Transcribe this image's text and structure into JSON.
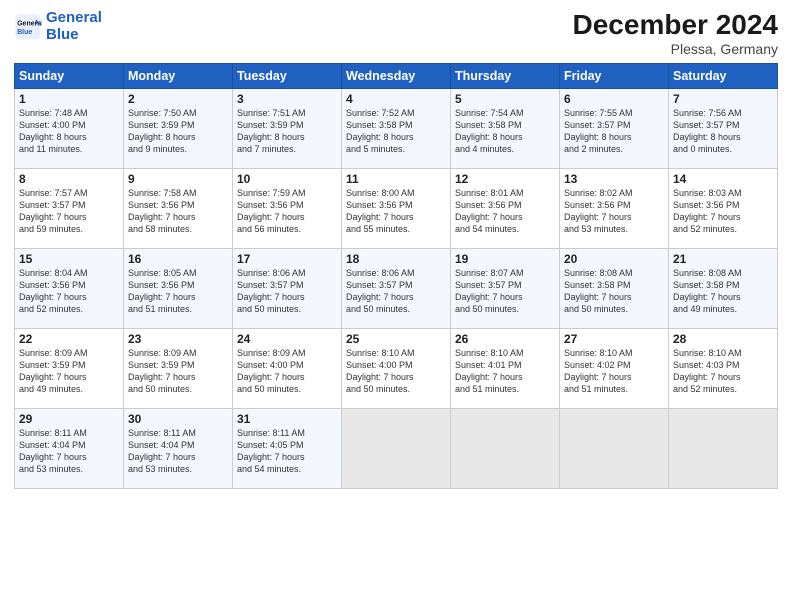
{
  "logo": {
    "line1": "General",
    "line2": "Blue"
  },
  "title": "December 2024",
  "subtitle": "Plessa, Germany",
  "days_of_week": [
    "Sunday",
    "Monday",
    "Tuesday",
    "Wednesday",
    "Thursday",
    "Friday",
    "Saturday"
  ],
  "weeks": [
    [
      {
        "day": "1",
        "info": "Sunrise: 7:48 AM\nSunset: 4:00 PM\nDaylight: 8 hours\nand 11 minutes."
      },
      {
        "day": "2",
        "info": "Sunrise: 7:50 AM\nSunset: 3:59 PM\nDaylight: 8 hours\nand 9 minutes."
      },
      {
        "day": "3",
        "info": "Sunrise: 7:51 AM\nSunset: 3:59 PM\nDaylight: 8 hours\nand 7 minutes."
      },
      {
        "day": "4",
        "info": "Sunrise: 7:52 AM\nSunset: 3:58 PM\nDaylight: 8 hours\nand 5 minutes."
      },
      {
        "day": "5",
        "info": "Sunrise: 7:54 AM\nSunset: 3:58 PM\nDaylight: 8 hours\nand 4 minutes."
      },
      {
        "day": "6",
        "info": "Sunrise: 7:55 AM\nSunset: 3:57 PM\nDaylight: 8 hours\nand 2 minutes."
      },
      {
        "day": "7",
        "info": "Sunrise: 7:56 AM\nSunset: 3:57 PM\nDaylight: 8 hours\nand 0 minutes."
      }
    ],
    [
      {
        "day": "8",
        "info": "Sunrise: 7:57 AM\nSunset: 3:57 PM\nDaylight: 7 hours\nand 59 minutes."
      },
      {
        "day": "9",
        "info": "Sunrise: 7:58 AM\nSunset: 3:56 PM\nDaylight: 7 hours\nand 58 minutes."
      },
      {
        "day": "10",
        "info": "Sunrise: 7:59 AM\nSunset: 3:56 PM\nDaylight: 7 hours\nand 56 minutes."
      },
      {
        "day": "11",
        "info": "Sunrise: 8:00 AM\nSunset: 3:56 PM\nDaylight: 7 hours\nand 55 minutes."
      },
      {
        "day": "12",
        "info": "Sunrise: 8:01 AM\nSunset: 3:56 PM\nDaylight: 7 hours\nand 54 minutes."
      },
      {
        "day": "13",
        "info": "Sunrise: 8:02 AM\nSunset: 3:56 PM\nDaylight: 7 hours\nand 53 minutes."
      },
      {
        "day": "14",
        "info": "Sunrise: 8:03 AM\nSunset: 3:56 PM\nDaylight: 7 hours\nand 52 minutes."
      }
    ],
    [
      {
        "day": "15",
        "info": "Sunrise: 8:04 AM\nSunset: 3:56 PM\nDaylight: 7 hours\nand 52 minutes."
      },
      {
        "day": "16",
        "info": "Sunrise: 8:05 AM\nSunset: 3:56 PM\nDaylight: 7 hours\nand 51 minutes."
      },
      {
        "day": "17",
        "info": "Sunrise: 8:06 AM\nSunset: 3:57 PM\nDaylight: 7 hours\nand 50 minutes."
      },
      {
        "day": "18",
        "info": "Sunrise: 8:06 AM\nSunset: 3:57 PM\nDaylight: 7 hours\nand 50 minutes."
      },
      {
        "day": "19",
        "info": "Sunrise: 8:07 AM\nSunset: 3:57 PM\nDaylight: 7 hours\nand 50 minutes."
      },
      {
        "day": "20",
        "info": "Sunrise: 8:08 AM\nSunset: 3:58 PM\nDaylight: 7 hours\nand 50 minutes."
      },
      {
        "day": "21",
        "info": "Sunrise: 8:08 AM\nSunset: 3:58 PM\nDaylight: 7 hours\nand 49 minutes."
      }
    ],
    [
      {
        "day": "22",
        "info": "Sunrise: 8:09 AM\nSunset: 3:59 PM\nDaylight: 7 hours\nand 49 minutes."
      },
      {
        "day": "23",
        "info": "Sunrise: 8:09 AM\nSunset: 3:59 PM\nDaylight: 7 hours\nand 50 minutes."
      },
      {
        "day": "24",
        "info": "Sunrise: 8:09 AM\nSunset: 4:00 PM\nDaylight: 7 hours\nand 50 minutes."
      },
      {
        "day": "25",
        "info": "Sunrise: 8:10 AM\nSunset: 4:00 PM\nDaylight: 7 hours\nand 50 minutes."
      },
      {
        "day": "26",
        "info": "Sunrise: 8:10 AM\nSunset: 4:01 PM\nDaylight: 7 hours\nand 51 minutes."
      },
      {
        "day": "27",
        "info": "Sunrise: 8:10 AM\nSunset: 4:02 PM\nDaylight: 7 hours\nand 51 minutes."
      },
      {
        "day": "28",
        "info": "Sunrise: 8:10 AM\nSunset: 4:03 PM\nDaylight: 7 hours\nand 52 minutes."
      }
    ],
    [
      {
        "day": "29",
        "info": "Sunrise: 8:11 AM\nSunset: 4:04 PM\nDaylight: 7 hours\nand 53 minutes."
      },
      {
        "day": "30",
        "info": "Sunrise: 8:11 AM\nSunset: 4:04 PM\nDaylight: 7 hours\nand 53 minutes."
      },
      {
        "day": "31",
        "info": "Sunrise: 8:11 AM\nSunset: 4:05 PM\nDaylight: 7 hours\nand 54 minutes."
      },
      {
        "day": "",
        "info": ""
      },
      {
        "day": "",
        "info": ""
      },
      {
        "day": "",
        "info": ""
      },
      {
        "day": "",
        "info": ""
      }
    ]
  ]
}
